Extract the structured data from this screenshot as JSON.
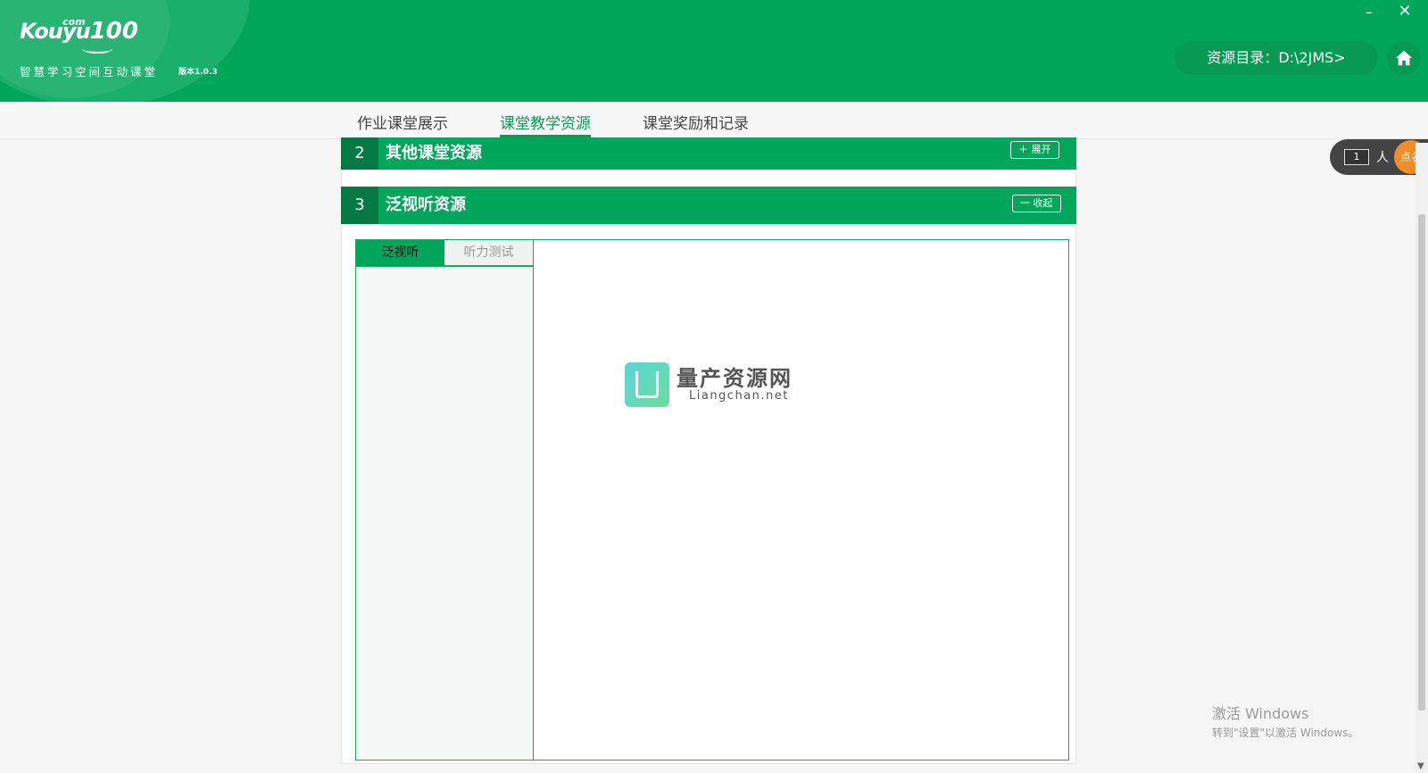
{
  "header": {
    "logo_main": "Kouyu",
    "logo_com": "com",
    "logo_num": "100",
    "subtitle": "智慧学习空间互动课堂",
    "version": "版本1.0.3",
    "resource_dir": "资源目录：D:\\2JMS>",
    "minimize_label": "–",
    "close_label": "✕"
  },
  "tabs": [
    {
      "label": "作业课堂展示",
      "active": false
    },
    {
      "label": "课堂教学资源",
      "active": true
    },
    {
      "label": "课堂奖励和记录",
      "active": false
    }
  ],
  "sections": [
    {
      "num": "2",
      "title": "其他课堂资源",
      "button": "＋ 展开"
    },
    {
      "num": "3",
      "title": "泛视听资源",
      "button": "一 收起"
    }
  ],
  "subtabs": [
    {
      "label": "泛视听",
      "active": true
    },
    {
      "label": "听力测试",
      "active": false
    }
  ],
  "watermark": {
    "title": "量产资源网",
    "sub": "Liangchan.net"
  },
  "callname": {
    "count": "1",
    "unit": "人",
    "button": "点名"
  },
  "scroll_arrow": "▼",
  "activation": {
    "line1": "激活 Windows",
    "line2": "转到\"设置\"以激活 Windows。"
  },
  "colors": {
    "primary": "#00a65a",
    "dark": "#047a42",
    "accent": "#f28c28"
  }
}
